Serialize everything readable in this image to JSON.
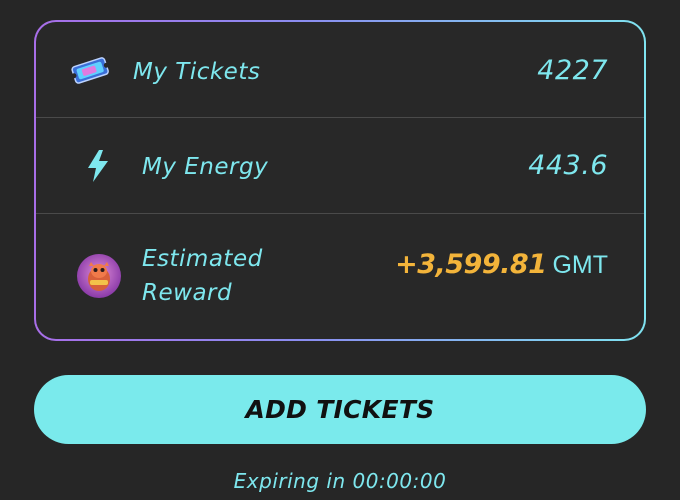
{
  "stats": {
    "tickets": {
      "label": "My Tickets",
      "value": "4227",
      "icon": "ticket-icon"
    },
    "energy": {
      "label": "My Energy",
      "value": "443.6",
      "icon": "lightning-bolt-icon"
    },
    "reward": {
      "label_line1": "Estimated",
      "label_line2": "Reward",
      "value": "+3,599.81",
      "unit": "GMT",
      "icon": "gmt-token-avatar-icon"
    }
  },
  "add_tickets_button": {
    "label": "ADD TICKETS"
  },
  "expiry": {
    "text": "Expiring in 00:00:00"
  },
  "colors": {
    "background": "#262626",
    "accent_cyan": "#7ee7ee",
    "button_fill": "#7aeaec",
    "reward_gold": "#f3b43a",
    "border_gradient_start": "#a86ee8",
    "border_gradient_end": "#7fe3f0"
  }
}
